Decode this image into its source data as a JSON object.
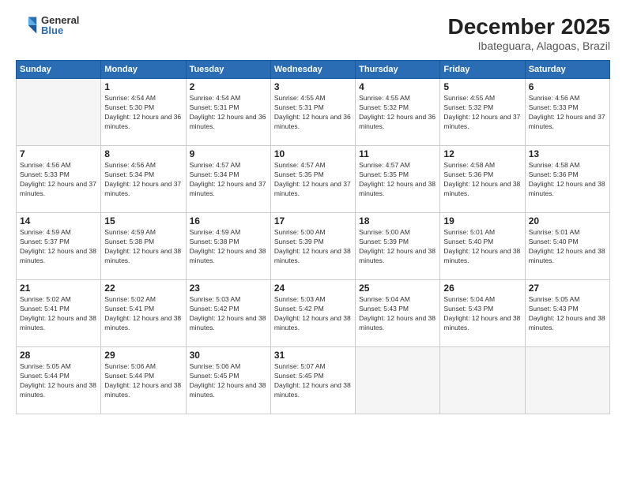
{
  "logo": {
    "general": "General",
    "blue": "Blue"
  },
  "header": {
    "month": "December 2025",
    "location": "Ibateguara, Alagoas, Brazil"
  },
  "weekdays": [
    "Sunday",
    "Monday",
    "Tuesday",
    "Wednesday",
    "Thursday",
    "Friday",
    "Saturday"
  ],
  "weeks": [
    [
      {
        "day": "",
        "empty": true
      },
      {
        "day": "1",
        "sunrise": "4:54 AM",
        "sunset": "5:30 PM",
        "daylight": "12 hours and 36 minutes."
      },
      {
        "day": "2",
        "sunrise": "4:54 AM",
        "sunset": "5:31 PM",
        "daylight": "12 hours and 36 minutes."
      },
      {
        "day": "3",
        "sunrise": "4:55 AM",
        "sunset": "5:31 PM",
        "daylight": "12 hours and 36 minutes."
      },
      {
        "day": "4",
        "sunrise": "4:55 AM",
        "sunset": "5:32 PM",
        "daylight": "12 hours and 36 minutes."
      },
      {
        "day": "5",
        "sunrise": "4:55 AM",
        "sunset": "5:32 PM",
        "daylight": "12 hours and 37 minutes."
      },
      {
        "day": "6",
        "sunrise": "4:56 AM",
        "sunset": "5:33 PM",
        "daylight": "12 hours and 37 minutes."
      }
    ],
    [
      {
        "day": "7",
        "sunrise": "4:56 AM",
        "sunset": "5:33 PM",
        "daylight": "12 hours and 37 minutes."
      },
      {
        "day": "8",
        "sunrise": "4:56 AM",
        "sunset": "5:34 PM",
        "daylight": "12 hours and 37 minutes."
      },
      {
        "day": "9",
        "sunrise": "4:57 AM",
        "sunset": "5:34 PM",
        "daylight": "12 hours and 37 minutes."
      },
      {
        "day": "10",
        "sunrise": "4:57 AM",
        "sunset": "5:35 PM",
        "daylight": "12 hours and 37 minutes."
      },
      {
        "day": "11",
        "sunrise": "4:57 AM",
        "sunset": "5:35 PM",
        "daylight": "12 hours and 38 minutes."
      },
      {
        "day": "12",
        "sunrise": "4:58 AM",
        "sunset": "5:36 PM",
        "daylight": "12 hours and 38 minutes."
      },
      {
        "day": "13",
        "sunrise": "4:58 AM",
        "sunset": "5:36 PM",
        "daylight": "12 hours and 38 minutes."
      }
    ],
    [
      {
        "day": "14",
        "sunrise": "4:59 AM",
        "sunset": "5:37 PM",
        "daylight": "12 hours and 38 minutes."
      },
      {
        "day": "15",
        "sunrise": "4:59 AM",
        "sunset": "5:38 PM",
        "daylight": "12 hours and 38 minutes."
      },
      {
        "day": "16",
        "sunrise": "4:59 AM",
        "sunset": "5:38 PM",
        "daylight": "12 hours and 38 minutes."
      },
      {
        "day": "17",
        "sunrise": "5:00 AM",
        "sunset": "5:39 PM",
        "daylight": "12 hours and 38 minutes."
      },
      {
        "day": "18",
        "sunrise": "5:00 AM",
        "sunset": "5:39 PM",
        "daylight": "12 hours and 38 minutes."
      },
      {
        "day": "19",
        "sunrise": "5:01 AM",
        "sunset": "5:40 PM",
        "daylight": "12 hours and 38 minutes."
      },
      {
        "day": "20",
        "sunrise": "5:01 AM",
        "sunset": "5:40 PM",
        "daylight": "12 hours and 38 minutes."
      }
    ],
    [
      {
        "day": "21",
        "sunrise": "5:02 AM",
        "sunset": "5:41 PM",
        "daylight": "12 hours and 38 minutes."
      },
      {
        "day": "22",
        "sunrise": "5:02 AM",
        "sunset": "5:41 PM",
        "daylight": "12 hours and 38 minutes."
      },
      {
        "day": "23",
        "sunrise": "5:03 AM",
        "sunset": "5:42 PM",
        "daylight": "12 hours and 38 minutes."
      },
      {
        "day": "24",
        "sunrise": "5:03 AM",
        "sunset": "5:42 PM",
        "daylight": "12 hours and 38 minutes."
      },
      {
        "day": "25",
        "sunrise": "5:04 AM",
        "sunset": "5:43 PM",
        "daylight": "12 hours and 38 minutes."
      },
      {
        "day": "26",
        "sunrise": "5:04 AM",
        "sunset": "5:43 PM",
        "daylight": "12 hours and 38 minutes."
      },
      {
        "day": "27",
        "sunrise": "5:05 AM",
        "sunset": "5:43 PM",
        "daylight": "12 hours and 38 minutes."
      }
    ],
    [
      {
        "day": "28",
        "sunrise": "5:05 AM",
        "sunset": "5:44 PM",
        "daylight": "12 hours and 38 minutes."
      },
      {
        "day": "29",
        "sunrise": "5:06 AM",
        "sunset": "5:44 PM",
        "daylight": "12 hours and 38 minutes."
      },
      {
        "day": "30",
        "sunrise": "5:06 AM",
        "sunset": "5:45 PM",
        "daylight": "12 hours and 38 minutes."
      },
      {
        "day": "31",
        "sunrise": "5:07 AM",
        "sunset": "5:45 PM",
        "daylight": "12 hours and 38 minutes."
      },
      {
        "day": "",
        "empty": true
      },
      {
        "day": "",
        "empty": true
      },
      {
        "day": "",
        "empty": true
      }
    ]
  ]
}
